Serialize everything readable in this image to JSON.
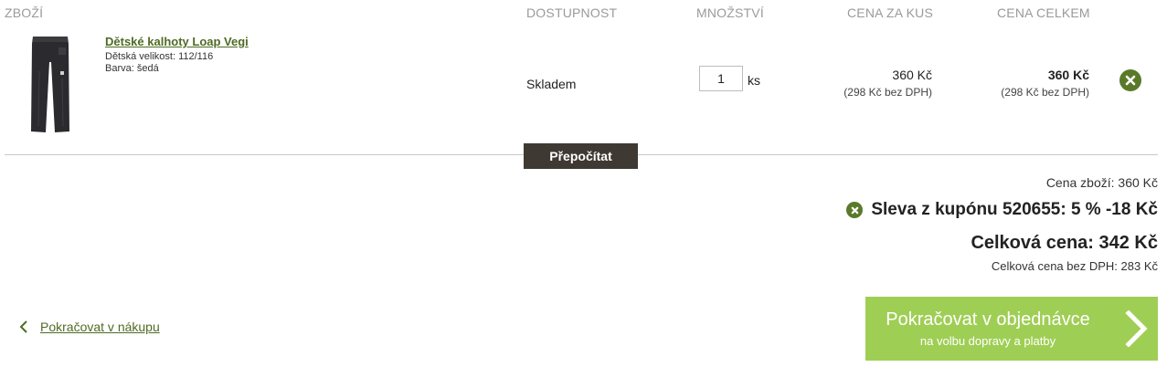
{
  "headers": {
    "product": "ZBOŽÍ",
    "availability": "DOSTUPNOST",
    "quantity": "MNOŽSTVÍ",
    "unit_price": "CENA ZA KUS",
    "total_price": "CENA CELKEM"
  },
  "item": {
    "name": "Dětské kalhoty Loap Vegi",
    "size": "Dětská velikost: 112/116",
    "color": "Barva: šedá",
    "availability": "Skladem",
    "quantity": "1",
    "unit": "ks",
    "unit_price": "360 Kč",
    "unit_price_net": "(298 Kč bez DPH)",
    "total_price": "360 Kč",
    "total_price_net": "(298 Kč bez DPH)",
    "remove_icon": "remove-circle-icon"
  },
  "actions": {
    "recalculate": "Přepočítat"
  },
  "summary": {
    "goods_price": "Cena zboží: 360 Kč",
    "coupon": "Sleva z kupónu 520655: 5 % -18 Kč",
    "total": "Celková cena: 342 Kč",
    "total_net": "Celková cena bez DPH: 283 Kč"
  },
  "nav": {
    "back": "Pokračovat v nákupu",
    "continue_main": "Pokračovat v objednávce",
    "continue_sub": "na volbu dopravy a platby"
  },
  "colors": {
    "accent_green": "#9fce55",
    "link_green": "#4f6b24",
    "icon_green": "#5a7a2a",
    "dark_button": "#3f3934"
  }
}
